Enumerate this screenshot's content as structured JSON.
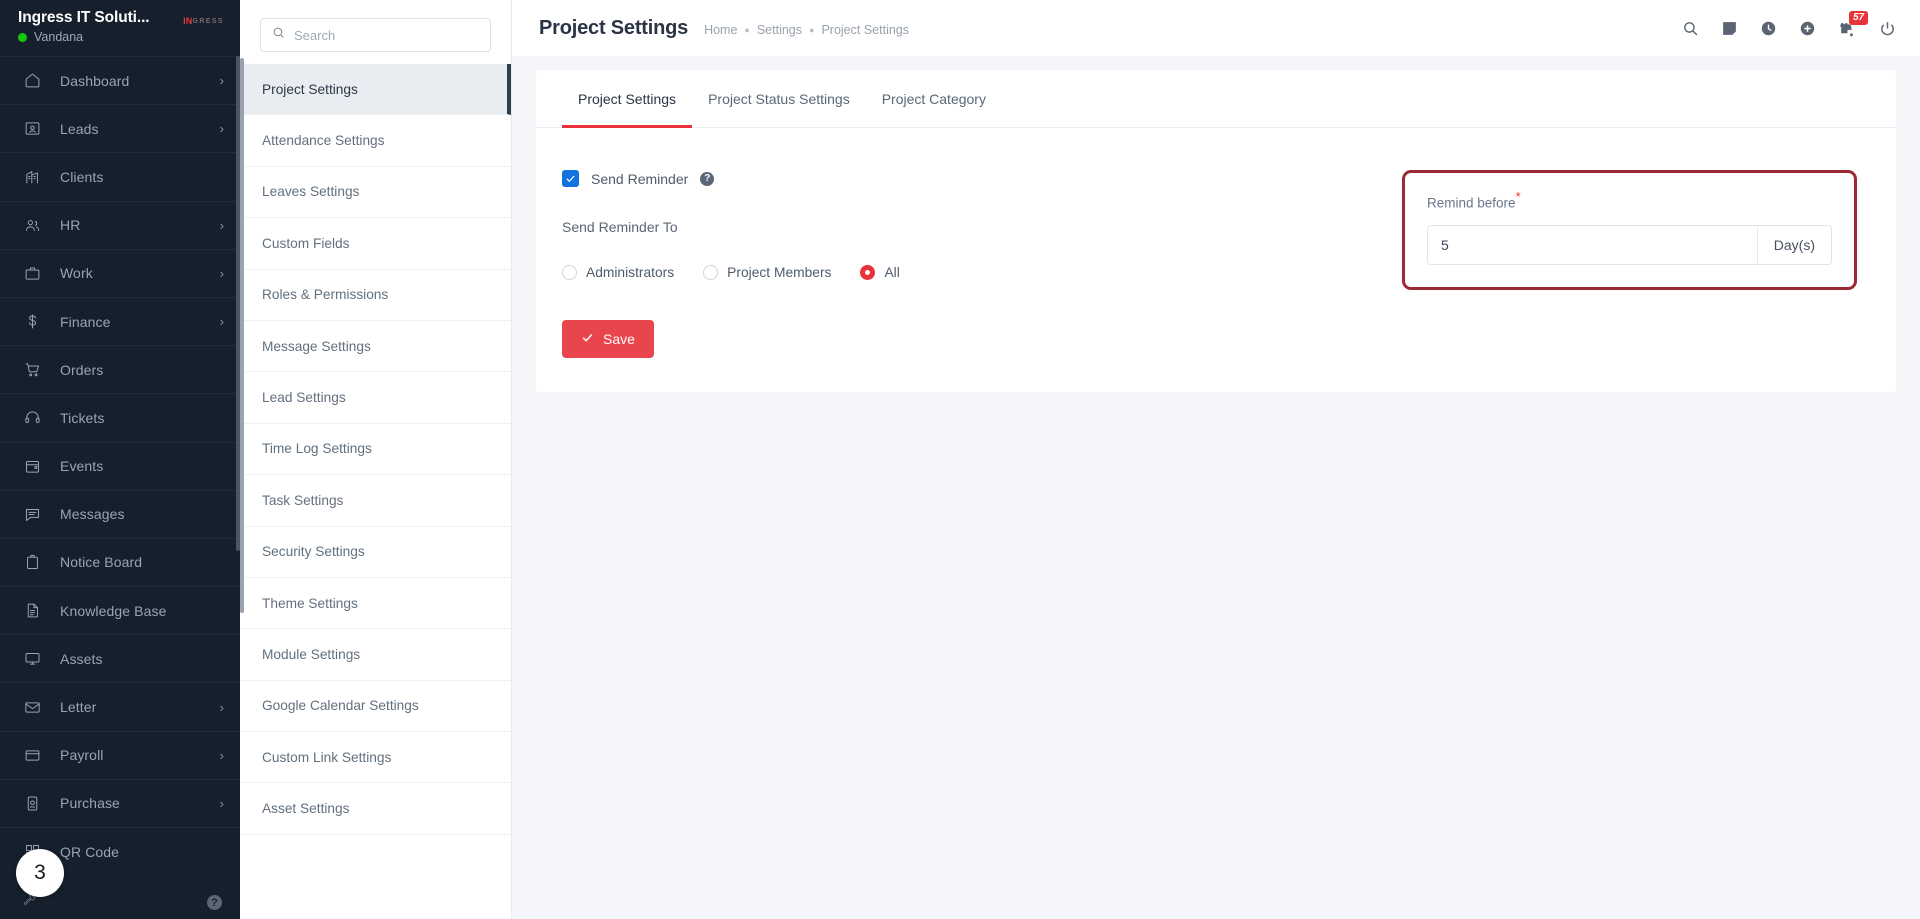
{
  "brand": {
    "company": "Ingress IT Soluti...",
    "user": "Vandana",
    "logo_primary": "IN",
    "logo_secondary": "GRESS"
  },
  "sidebar": {
    "items": [
      {
        "label": "Dashboard",
        "icon": "home-icon",
        "chevron": "›"
      },
      {
        "label": "Leads",
        "icon": "lead-card-icon",
        "chevron": "›"
      },
      {
        "label": "Clients",
        "icon": "building-icon",
        "chevron": ""
      },
      {
        "label": "HR",
        "icon": "people-icon",
        "chevron": "›"
      },
      {
        "label": "Work",
        "icon": "briefcase-icon",
        "chevron": "›"
      },
      {
        "label": "Finance",
        "icon": "dollar-icon",
        "chevron": "›"
      },
      {
        "label": "Orders",
        "icon": "cart-icon",
        "chevron": ""
      },
      {
        "label": "Tickets",
        "icon": "headset-icon",
        "chevron": ""
      },
      {
        "label": "Events",
        "icon": "calendar-icon",
        "chevron": ""
      },
      {
        "label": "Messages",
        "icon": "chat-icon",
        "chevron": ""
      },
      {
        "label": "Notice Board",
        "icon": "clipboard-icon",
        "chevron": ""
      },
      {
        "label": "Knowledge Base",
        "icon": "document-icon",
        "chevron": ""
      },
      {
        "label": "Assets",
        "icon": "monitor-icon",
        "chevron": ""
      },
      {
        "label": "Letter",
        "icon": "envelope-icon",
        "chevron": "›"
      },
      {
        "label": "Payroll",
        "icon": "payroll-icon",
        "chevron": "›"
      },
      {
        "label": "Purchase",
        "icon": "purchase-icon",
        "chevron": "›"
      },
      {
        "label": "QR Code",
        "icon": "qr-code-icon",
        "chevron": ""
      }
    ],
    "footer": {
      "wrench": "wrench-icon",
      "help": "?"
    },
    "cursor_badge": "3"
  },
  "settings_panel": {
    "search_placeholder": "Search",
    "search_value": "",
    "items": [
      "Project Settings",
      "Attendance Settings",
      "Leaves Settings",
      "Custom Fields",
      "Roles & Permissions",
      "Message Settings",
      "Lead Settings",
      "Time Log Settings",
      "Task Settings",
      "Security Settings",
      "Theme Settings",
      "Module Settings",
      "Google Calendar Settings",
      "Custom Link Settings",
      "Asset Settings"
    ],
    "active_index": 0
  },
  "topbar": {
    "title": "Project Settings",
    "breadcrumbs": [
      "Home",
      "Settings",
      "Project Settings"
    ],
    "separator": "●",
    "icons": [
      "search-icon",
      "note-icon",
      "clock-icon",
      "plus-circle-icon",
      "gift-bell-icon",
      "power-icon"
    ],
    "notification_count": "57"
  },
  "main": {
    "tabs": [
      {
        "label": "Project Settings",
        "active": true
      },
      {
        "label": "Project Status Settings",
        "active": false
      },
      {
        "label": "Project Category",
        "active": false
      }
    ],
    "form": {
      "send_reminder_label": "Send Reminder",
      "send_reminder_checked": true,
      "help_glyph": "?",
      "send_reminder_to_label": "Send Reminder To",
      "radio_options": [
        {
          "label": "Administrators",
          "selected": false
        },
        {
          "label": "Project Members",
          "selected": false
        },
        {
          "label": "All",
          "selected": true
        }
      ],
      "remind_before_label": "Remind before",
      "required_mark": "*",
      "remind_before_value": "5",
      "remind_before_unit": "Day(s)"
    },
    "save_label": "Save"
  },
  "colors": {
    "accent_red": "#e8333a",
    "highlight_border": "#9c2a35",
    "checkbox_blue": "#1273e0",
    "sidebar_bg": "#161f2c",
    "status_green": "#16c60c"
  }
}
